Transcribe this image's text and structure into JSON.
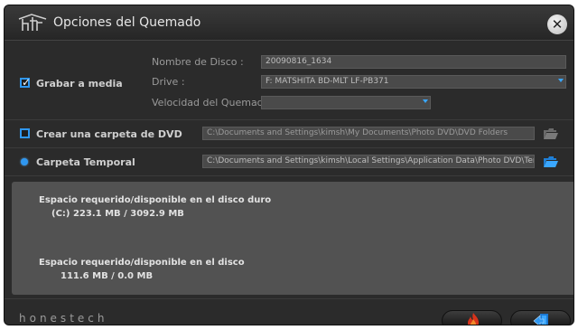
{
  "window": {
    "title": "Opciones del Quemado",
    "close_label": "✕"
  },
  "burn": {
    "checkbox_label": "Grabar a media",
    "checked": true,
    "disc_name_label": "Nombre de Disco :",
    "disc_name_value": "20090816_1634",
    "drive_label": "Drive :",
    "drive_value": "F: MATSHITA BD-MLT LF-PB371",
    "speed_label": "Velocidad del Quemado :",
    "speed_value": ""
  },
  "dvd_folder": {
    "checkbox_label": "Crear una carpeta de DVD",
    "checked": false,
    "path": "C:\\Documents and Settings\\kimsh\\My Documents\\Photo DVD\\DVD Folders"
  },
  "temp_folder": {
    "label": "Carpeta Temporal",
    "path": "C:\\Documents and Settings\\kimsh\\Local Settings\\Application Data\\Photo DVD\\Temp"
  },
  "info": {
    "hdd_heading": "Espacio requerido/disponible en el disco duro",
    "hdd_value": "(C:)  223.1 MB / 3092.9 MB",
    "disc_heading": "Espacio requerido/disponible en el disco",
    "disc_value": "111.6 MB / 0.0 MB"
  },
  "footer": {
    "brand": "honestech"
  },
  "colors": {
    "accent": "#2f97f0",
    "background": "#2b2b2b",
    "panel": "#525252"
  },
  "icons": {
    "close": "close-icon",
    "folder": "folder-icon",
    "burn": "flame-icon",
    "exit": "exit-icon"
  }
}
